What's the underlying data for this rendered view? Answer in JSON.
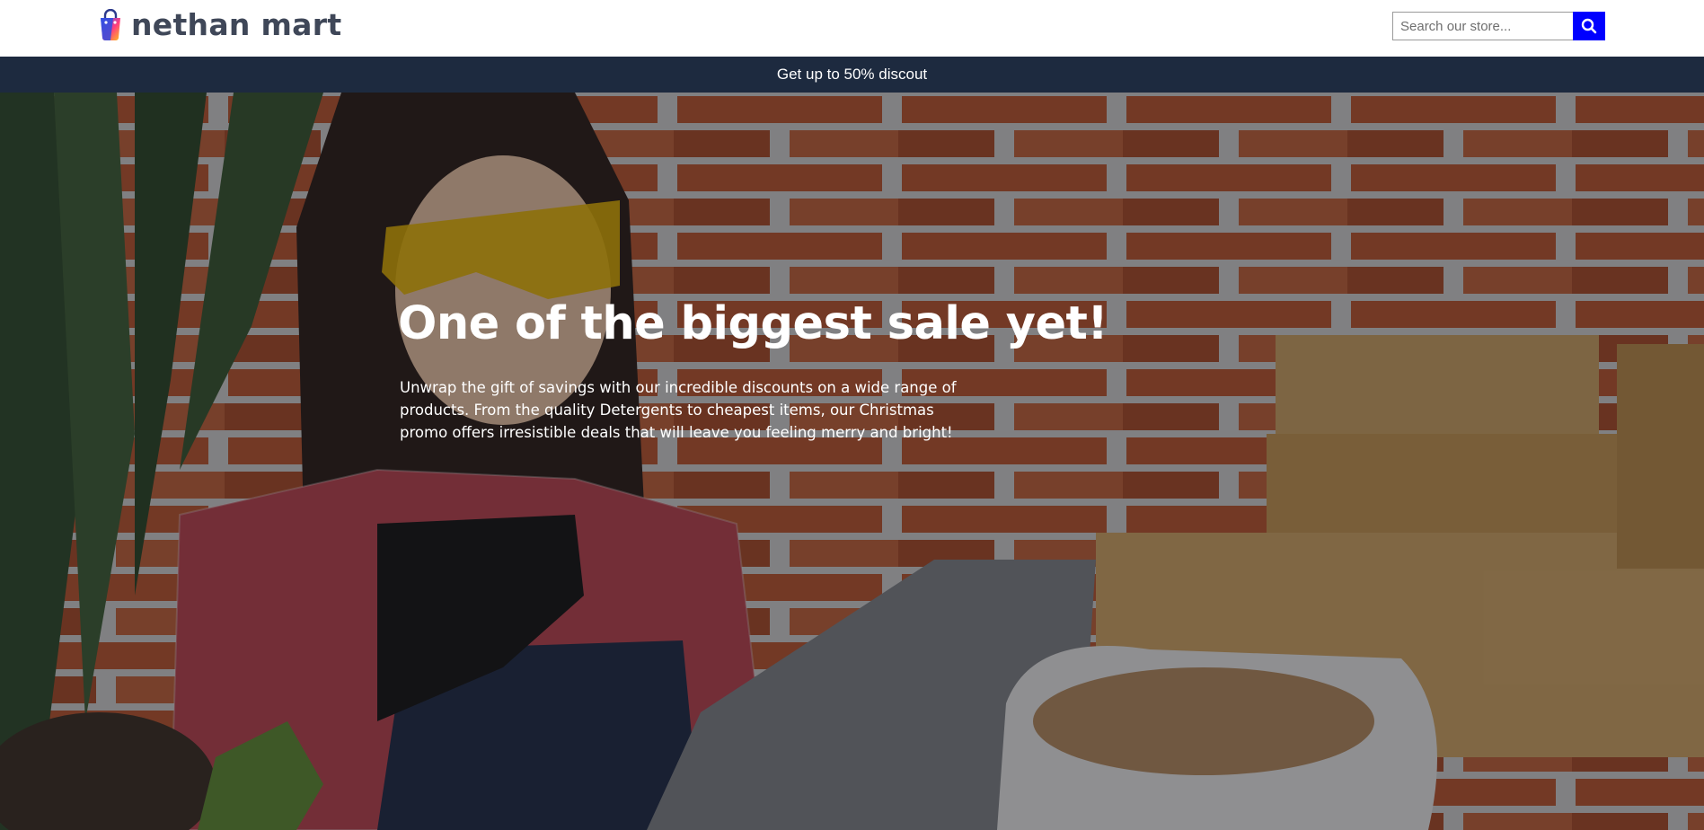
{
  "header": {
    "logo_text": "nethan mart",
    "logo_icon": "shopping-bag-icon",
    "search": {
      "placeholder": "Search our store...",
      "value": "",
      "button_icon": "search-icon"
    }
  },
  "announcement": {
    "text": "Get up to 50% discout"
  },
  "hero": {
    "title": "One of the biggest sale yet!",
    "description": "Unwrap the gift of savings with our incredible discounts on a wide range of products. From the quality Detergents to cheapest items, our Christmas promo offers irresistible deals that will leave you feeling merry and bright!"
  },
  "colors": {
    "brand_text": "#3f4758",
    "search_button": "#0000ff",
    "announcement_bg": "#1d2a3f",
    "text_on_dark": "#ffffff"
  }
}
